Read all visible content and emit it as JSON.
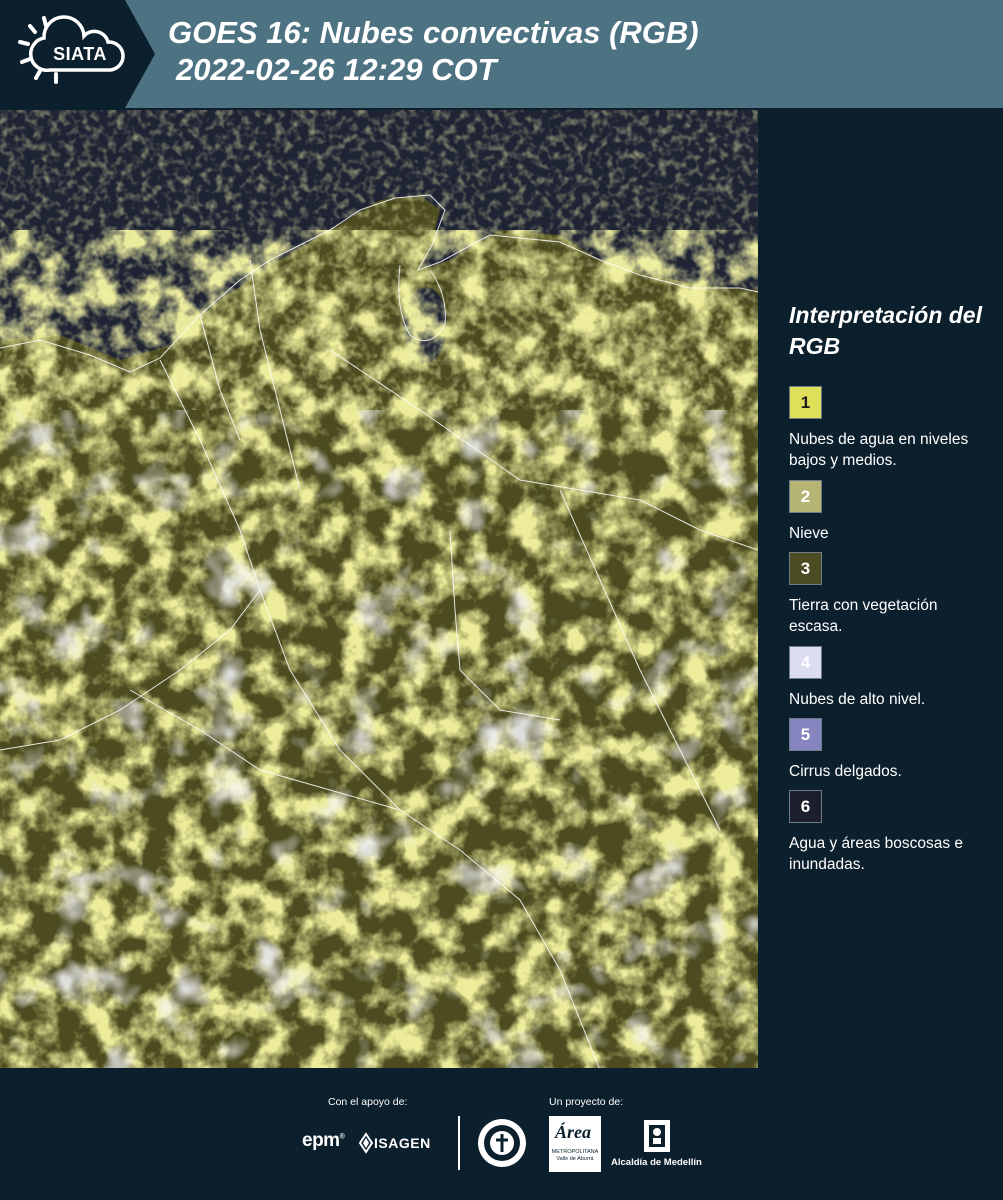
{
  "header": {
    "logo_text": "SIATA",
    "title_line1": "GOES 16: Nubes convectivas (RGB)",
    "title_line2": "2022-02-26 12:29 COT",
    "band_color": "#4d7382",
    "logo_color": "#0c1f2c"
  },
  "map": {
    "description_icon": "satellite-map-image",
    "cloud_color": "#e8e85a",
    "high_cloud_color": "#e6e6f2",
    "land_color": "#4c4c20",
    "water_color": "#1f2434"
  },
  "legend": {
    "title": "Interpretación del RGB",
    "items": [
      {
        "number": "1",
        "label": "Nubes de agua en niveles bajos y medios.",
        "color": "#e0df5a",
        "text_color": "#1b1b1b"
      },
      {
        "number": "2",
        "label": "Nieve",
        "color": "#b6b576",
        "text_color": "#ffffff"
      },
      {
        "number": "3",
        "label": "Tierra con vegetación escasa.",
        "color": "#4b4c23",
        "text_color": "#ffffff"
      },
      {
        "number": "4",
        "label": "Nubes de alto nivel.",
        "color": "#dcdcf2",
        "text_color": "#ffffff"
      },
      {
        "number": "5",
        "label": "Cirrus delgados.",
        "color": "#8785bf",
        "text_color": "#ffffff"
      },
      {
        "number": "6",
        "label": "Agua y áreas boscosas e inundadas.",
        "color": "#1d1e2b",
        "text_color": "#ffffff"
      }
    ]
  },
  "footer": {
    "support_label": "Con el apoyo de:",
    "project_label": "Un proyecto de:",
    "epm": "epm",
    "isagen": "ISAGEN",
    "area_script": "Área",
    "area_sub": "METROPOLITANA Valle de Aburrá",
    "alcaldia": "Alcaldía de Medellín"
  }
}
